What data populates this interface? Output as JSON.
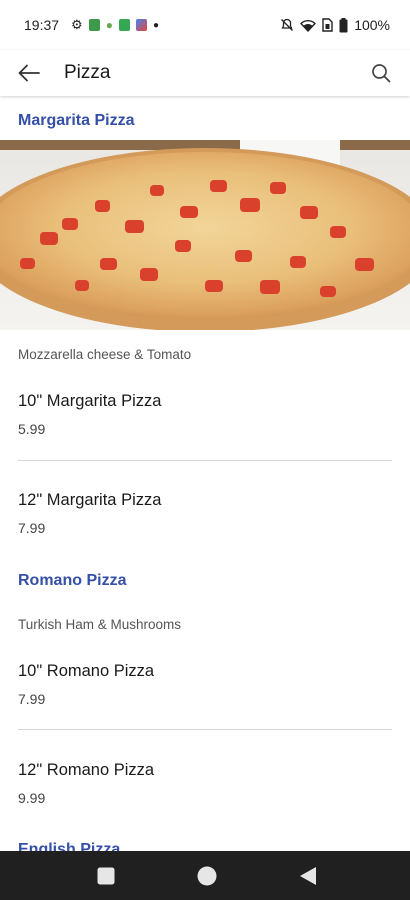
{
  "status_bar": {
    "time": "19:37",
    "battery": "100%",
    "icons": [
      "settings-icon",
      "app-icon",
      "android-icon",
      "app-icon",
      "app-icon",
      "dot-icon",
      "notifications-off-icon",
      "wifi-icon",
      "sim-icon",
      "battery-icon"
    ]
  },
  "app_bar": {
    "title": "Pizza",
    "back_icon": "arrow-back-icon",
    "search_icon": "search-icon"
  },
  "menu": {
    "margarita": {
      "title": "Margarita Pizza",
      "description": "Mozzarella cheese & Tomato",
      "items": [
        {
          "name": "10\" Margarita Pizza",
          "price": "5.99"
        },
        {
          "name": "12\" Margarita Pizza",
          "price": "7.99"
        }
      ]
    },
    "romano": {
      "title": "Romano Pizza",
      "description": "Turkish Ham & Mushrooms",
      "items": [
        {
          "name": "10\" Romano Pizza",
          "price": "7.99"
        },
        {
          "name": "12\" Romano Pizza",
          "price": "9.99"
        }
      ]
    },
    "english": {
      "title": "English Pizza"
    }
  },
  "colors": {
    "accent": "#3550a6",
    "nav_bar": "#202020"
  }
}
